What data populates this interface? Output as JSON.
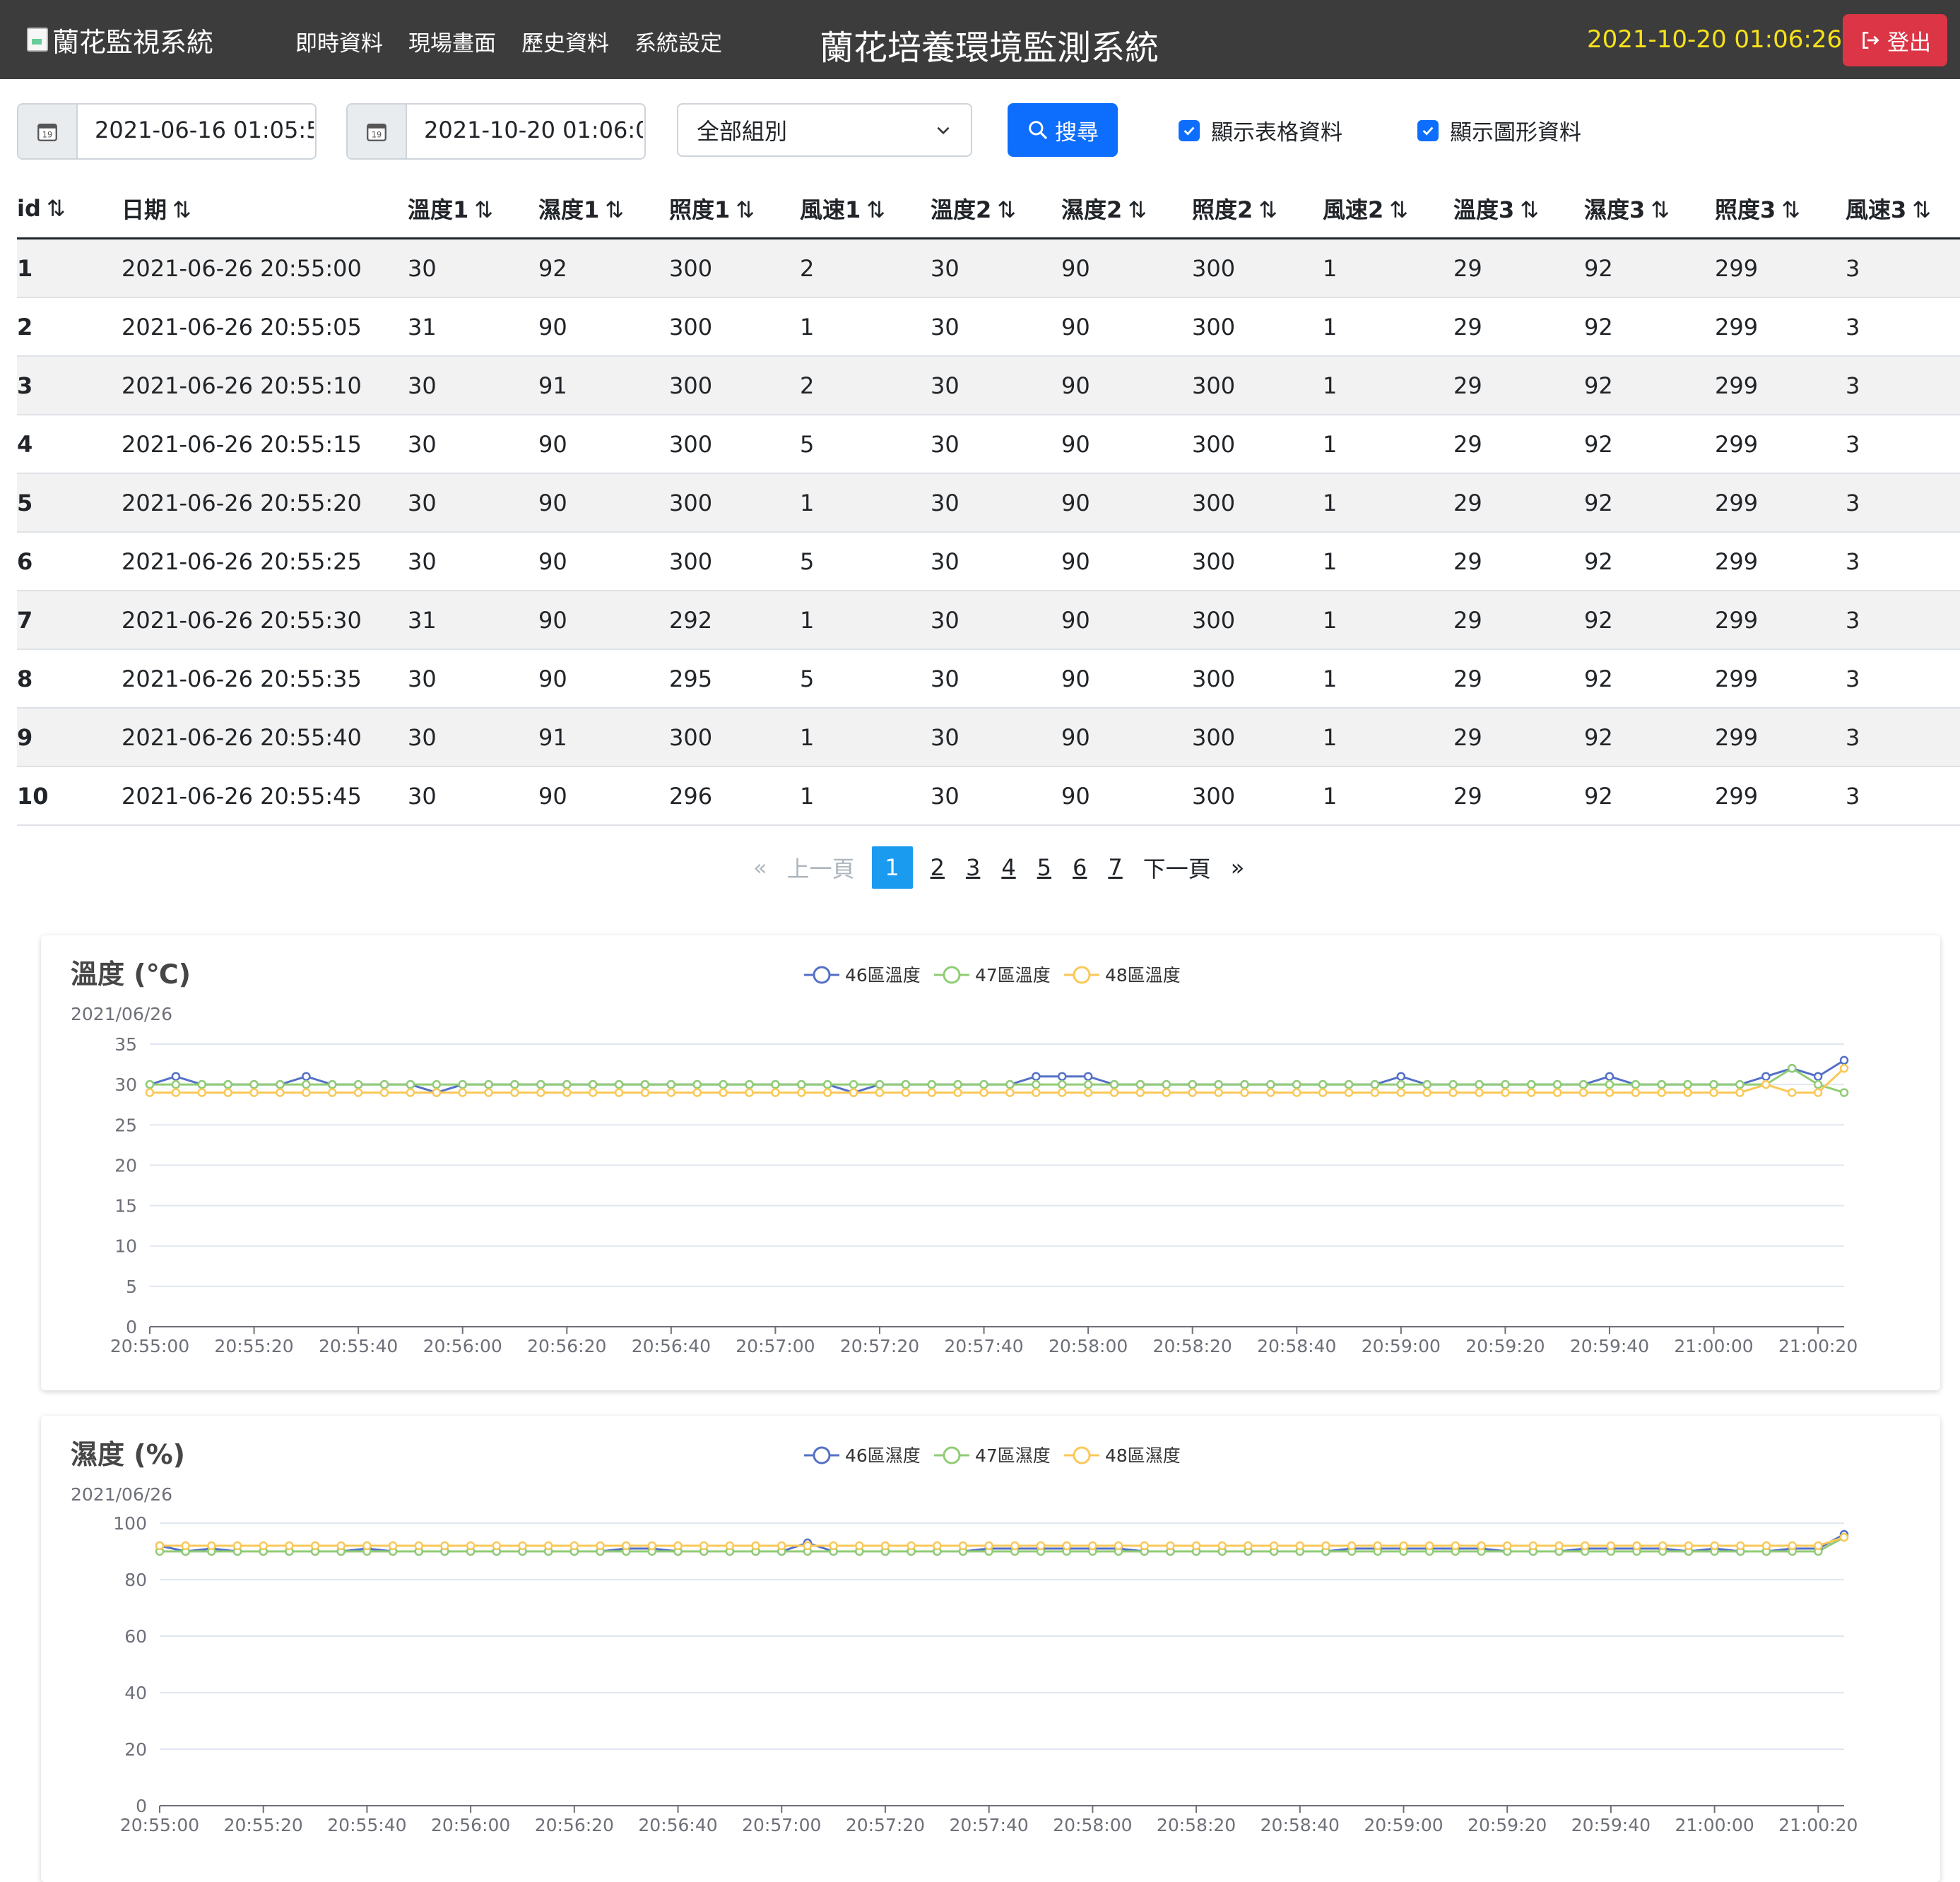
{
  "header": {
    "brand": "蘭花監視系統",
    "nav": [
      "即時資料",
      "現場畫面",
      "歷史資料",
      "系統設定"
    ],
    "system_title": "蘭花培養環境監測系統",
    "clock": "2021-10-20 01:06:26",
    "logout_label": "登出"
  },
  "filters": {
    "start_date": "2021-06-16 01:05:5",
    "end_date": "2021-10-20 01:06:0",
    "calendar_icon_text": "19",
    "group_select": "全部組別",
    "search_label": "搜尋",
    "show_table_label": "顯示表格資料",
    "show_chart_label": "顯示圖形資料",
    "show_table_checked": true,
    "show_chart_checked": true
  },
  "table": {
    "columns": [
      "id",
      "日期",
      "溫度1",
      "濕度1",
      "照度1",
      "風速1",
      "溫度2",
      "濕度2",
      "照度2",
      "風速2",
      "溫度3",
      "濕度3",
      "照度3",
      "風速3"
    ],
    "sort_glyph": "⇅",
    "rows": [
      [
        "1",
        "2021-06-26 20:55:00",
        "30",
        "92",
        "300",
        "2",
        "30",
        "90",
        "300",
        "1",
        "29",
        "92",
        "299",
        "3"
      ],
      [
        "2",
        "2021-06-26 20:55:05",
        "31",
        "90",
        "300",
        "1",
        "30",
        "90",
        "300",
        "1",
        "29",
        "92",
        "299",
        "3"
      ],
      [
        "3",
        "2021-06-26 20:55:10",
        "30",
        "91",
        "300",
        "2",
        "30",
        "90",
        "300",
        "1",
        "29",
        "92",
        "299",
        "3"
      ],
      [
        "4",
        "2021-06-26 20:55:15",
        "30",
        "90",
        "300",
        "5",
        "30",
        "90",
        "300",
        "1",
        "29",
        "92",
        "299",
        "3"
      ],
      [
        "5",
        "2021-06-26 20:55:20",
        "30",
        "90",
        "300",
        "1",
        "30",
        "90",
        "300",
        "1",
        "29",
        "92",
        "299",
        "3"
      ],
      [
        "6",
        "2021-06-26 20:55:25",
        "30",
        "90",
        "300",
        "5",
        "30",
        "90",
        "300",
        "1",
        "29",
        "92",
        "299",
        "3"
      ],
      [
        "7",
        "2021-06-26 20:55:30",
        "31",
        "90",
        "292",
        "1",
        "30",
        "90",
        "300",
        "1",
        "29",
        "92",
        "299",
        "3"
      ],
      [
        "8",
        "2021-06-26 20:55:35",
        "30",
        "90",
        "295",
        "5",
        "30",
        "90",
        "300",
        "1",
        "29",
        "92",
        "299",
        "3"
      ],
      [
        "9",
        "2021-06-26 20:55:40",
        "30",
        "91",
        "300",
        "1",
        "30",
        "90",
        "300",
        "1",
        "29",
        "92",
        "299",
        "3"
      ],
      [
        "10",
        "2021-06-26 20:55:45",
        "30",
        "90",
        "296",
        "1",
        "30",
        "90",
        "300",
        "1",
        "29",
        "92",
        "299",
        "3"
      ]
    ]
  },
  "pagination": {
    "first": "«",
    "prev": "上一頁",
    "next": "下一頁",
    "last": "»",
    "pages": [
      "1",
      "2",
      "3",
      "4",
      "5",
      "6",
      "7"
    ],
    "current": "1"
  },
  "colors": {
    "series_46": "#5470c6",
    "series_47": "#91cc75",
    "series_48": "#fac858",
    "header_bg": "#3c3c3c",
    "clock": "#f7e21a",
    "logout": "#dc3545",
    "primary": "#0d6efd",
    "active_page": "#1a9bf0"
  },
  "chart_data": [
    {
      "type": "line",
      "title": "溫度 (℃)",
      "subtitle": "2021/06/26",
      "legend_position": "top-center",
      "grid": true,
      "ylim": [
        0,
        35
      ],
      "y_ticks": [
        "0",
        "5",
        "10",
        "15",
        "20",
        "25",
        "30",
        "35"
      ],
      "x_ticks": [
        "20:55:00",
        "20:55:20",
        "20:55:40",
        "20:56:00",
        "20:56:20",
        "20:56:40",
        "20:57:00",
        "20:57:20",
        "20:57:40",
        "20:58:00",
        "20:58:20",
        "20:58:40",
        "20:59:00",
        "20:59:20",
        "20:59:40",
        "21:00:00",
        "21:00:20"
      ],
      "x_start": "20:55:00",
      "x_step_seconds": 5,
      "series": [
        {
          "name": "46區溫度",
          "values": [
            30,
            31,
            30,
            30,
            30,
            30,
            31,
            30,
            30,
            30,
            30,
            29,
            30,
            30,
            30,
            30,
            30,
            30,
            30,
            30,
            30,
            30,
            30,
            30,
            30,
            30,
            30,
            29,
            30,
            30,
            30,
            30,
            30,
            30,
            31,
            31,
            31,
            30,
            30,
            30,
            30,
            30,
            30,
            30,
            30,
            30,
            30,
            30,
            31,
            30,
            30,
            30,
            30,
            30,
            30,
            30,
            31,
            30,
            30,
            30,
            30,
            30,
            31,
            32,
            31,
            33
          ]
        },
        {
          "name": "47區溫度",
          "values": [
            30,
            30,
            30,
            30,
            30,
            30,
            30,
            30,
            30,
            30,
            30,
            30,
            30,
            30,
            30,
            30,
            30,
            30,
            30,
            30,
            30,
            30,
            30,
            30,
            30,
            30,
            30,
            30,
            30,
            30,
            30,
            30,
            30,
            30,
            30,
            30,
            30,
            30,
            30,
            30,
            30,
            30,
            30,
            30,
            30,
            30,
            30,
            30,
            30,
            30,
            30,
            30,
            30,
            30,
            30,
            30,
            30,
            30,
            30,
            30,
            30,
            30,
            30,
            32,
            30,
            29
          ]
        },
        {
          "name": "48區溫度",
          "values": [
            29,
            29,
            29,
            29,
            29,
            29,
            29,
            29,
            29,
            29,
            29,
            29,
            29,
            29,
            29,
            29,
            29,
            29,
            29,
            29,
            29,
            29,
            29,
            29,
            29,
            29,
            29,
            29,
            29,
            29,
            29,
            29,
            29,
            29,
            29,
            29,
            29,
            29,
            29,
            29,
            29,
            29,
            29,
            29,
            29,
            29,
            29,
            29,
            29,
            29,
            29,
            29,
            29,
            29,
            29,
            29,
            29,
            29,
            29,
            29,
            29,
            29,
            30,
            29,
            29,
            32
          ]
        }
      ]
    },
    {
      "type": "line",
      "title": "濕度 (%)",
      "subtitle": "2021/06/26",
      "legend_position": "top-center",
      "grid": true,
      "ylim": [
        0,
        100
      ],
      "y_ticks": [
        "0",
        "20",
        "40",
        "60",
        "80",
        "100"
      ],
      "x_ticks": [
        "20:55:00",
        "20:55:20",
        "20:55:40",
        "20:56:00",
        "20:56:20",
        "20:56:40",
        "20:57:00",
        "20:57:20",
        "20:57:40",
        "20:58:00",
        "20:58:20",
        "20:58:40",
        "20:59:00",
        "20:59:20",
        "20:59:40",
        "21:00:00",
        "21:00:20"
      ],
      "x_start": "20:55:00",
      "x_step_seconds": 5,
      "series": [
        {
          "name": "46區濕度",
          "values": [
            92,
            90,
            91,
            90,
            90,
            90,
            90,
            90,
            91,
            90,
            90,
            90,
            90,
            90,
            90,
            90,
            90,
            90,
            91,
            91,
            90,
            90,
            90,
            90,
            90,
            93,
            90,
            90,
            90,
            90,
            90,
            90,
            91,
            91,
            91,
            91,
            91,
            91,
            90,
            90,
            90,
            90,
            90,
            90,
            90,
            90,
            91,
            91,
            91,
            91,
            91,
            91,
            90,
            90,
            90,
            91,
            91,
            91,
            91,
            90,
            91,
            90,
            90,
            91,
            91,
            96
          ]
        },
        {
          "name": "47區濕度",
          "values": [
            90,
            90,
            90,
            90,
            90,
            90,
            90,
            90,
            90,
            90,
            90,
            90,
            90,
            90,
            90,
            90,
            90,
            90,
            90,
            90,
            90,
            90,
            90,
            90,
            90,
            90,
            90,
            90,
            90,
            90,
            90,
            90,
            90,
            90,
            90,
            90,
            90,
            90,
            90,
            90,
            90,
            90,
            90,
            90,
            90,
            90,
            90,
            90,
            90,
            90,
            90,
            90,
            90,
            90,
            90,
            90,
            90,
            90,
            90,
            90,
            90,
            90,
            90,
            90,
            90,
            95
          ]
        },
        {
          "name": "48區濕度",
          "values": [
            92,
            92,
            92,
            92,
            92,
            92,
            92,
            92,
            92,
            92,
            92,
            92,
            92,
            92,
            92,
            92,
            92,
            92,
            92,
            92,
            92,
            92,
            92,
            92,
            92,
            92,
            92,
            92,
            92,
            92,
            92,
            92,
            92,
            92,
            92,
            92,
            92,
            92,
            92,
            92,
            92,
            92,
            92,
            92,
            92,
            92,
            92,
            92,
            92,
            92,
            92,
            92,
            92,
            92,
            92,
            92,
            92,
            92,
            92,
            92,
            92,
            92,
            92,
            92,
            92,
            95
          ]
        }
      ]
    }
  ]
}
